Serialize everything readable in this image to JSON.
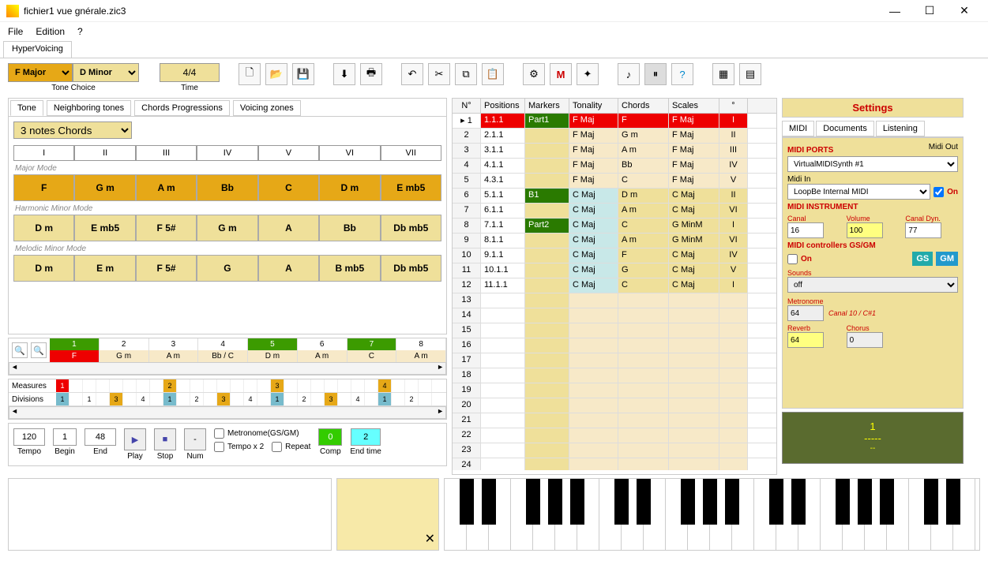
{
  "window": {
    "title": "fichier1 vue gnérale.zic3"
  },
  "menu": {
    "file": "File",
    "edition": "Edition",
    "help": "?"
  },
  "app_tab": "HyperVoicing",
  "tone": {
    "major": "F Major",
    "minor": "D Minor",
    "label": "Tone Choice"
  },
  "time": {
    "value": "4/4",
    "label": "Time"
  },
  "subtabs": {
    "tone": "Tone",
    "neighbor": "Neighboring tones",
    "prog": "Chords Progressions",
    "voicing": "Voicing zones"
  },
  "chord_type": "3 notes Chords",
  "degrees": [
    "I",
    "II",
    "III",
    "IV",
    "V",
    "VI",
    "VII"
  ],
  "modes": {
    "major": {
      "label": "Major Mode",
      "chords": [
        "F",
        "G m",
        "A m",
        "Bb",
        "C",
        "D m",
        "E mb5"
      ]
    },
    "harmonic": {
      "label": "Harmonic Minor Mode",
      "chords": [
        "D m",
        "E mb5",
        "F 5#",
        "G m",
        "A",
        "Bb",
        "Db mb5"
      ]
    },
    "melodic": {
      "label": "Melodic Minor Mode",
      "chords": [
        "D m",
        "E m",
        "F 5#",
        "G",
        "A",
        "B mb5",
        "Db mb5"
      ]
    }
  },
  "seq": {
    "nums": [
      "1",
      "2",
      "3",
      "4",
      "5",
      "6",
      "7",
      "8"
    ],
    "greens": [
      0,
      4,
      6
    ],
    "chords": [
      "F",
      "G m",
      "A m",
      "Bb / C",
      "D m",
      "A m",
      "C",
      "A m"
    ],
    "red": 0
  },
  "meas": {
    "label_m": "Measures",
    "label_d": "Divisions",
    "measures": [
      {
        "v": "1",
        "c": "r"
      },
      {
        "v": ""
      },
      {
        "v": ""
      },
      {
        "v": ""
      },
      {
        "v": ""
      },
      {
        "v": ""
      },
      {
        "v": ""
      },
      {
        "v": ""
      },
      {
        "v": "2",
        "c": "o"
      },
      {
        "v": ""
      },
      {
        "v": ""
      },
      {
        "v": ""
      },
      {
        "v": ""
      },
      {
        "v": ""
      },
      {
        "v": ""
      },
      {
        "v": ""
      },
      {
        "v": "3",
        "c": "o"
      },
      {
        "v": ""
      },
      {
        "v": ""
      },
      {
        "v": ""
      },
      {
        "v": ""
      },
      {
        "v": ""
      },
      {
        "v": ""
      },
      {
        "v": ""
      },
      {
        "v": "4",
        "c": "o"
      },
      {
        "v": ""
      },
      {
        "v": ""
      },
      {
        "v": ""
      }
    ],
    "divisions": [
      {
        "v": "1",
        "c": "b"
      },
      {
        "v": ""
      },
      {
        "v": "1"
      },
      {
        "v": ""
      },
      {
        "v": "3",
        "c": "o"
      },
      {
        "v": ""
      },
      {
        "v": "4"
      },
      {
        "v": ""
      },
      {
        "v": "1",
        "c": "b"
      },
      {
        "v": ""
      },
      {
        "v": "2"
      },
      {
        "v": ""
      },
      {
        "v": "3",
        "c": "o"
      },
      {
        "v": ""
      },
      {
        "v": "4"
      },
      {
        "v": ""
      },
      {
        "v": "1",
        "c": "b"
      },
      {
        "v": ""
      },
      {
        "v": "2"
      },
      {
        "v": ""
      },
      {
        "v": "3",
        "c": "o"
      },
      {
        "v": ""
      },
      {
        "v": "4"
      },
      {
        "v": ""
      },
      {
        "v": "1",
        "c": "b"
      },
      {
        "v": ""
      },
      {
        "v": "2"
      },
      {
        "v": ""
      }
    ]
  },
  "transport": {
    "tempo": "120",
    "tempo_l": "Tempo",
    "begin": "1",
    "begin_l": "Begin",
    "end": "48",
    "end_l": "End",
    "play_l": "Play",
    "stop_l": "Stop",
    "num_l": "Num",
    "num_btn": "-",
    "metronome": "Metronome(GS/GM)",
    "tempox2": "Tempo x 2",
    "repeat": "Repeat",
    "comp": "0",
    "comp_l": "Comp",
    "endtime": "2",
    "endtime_l": "End time"
  },
  "table": {
    "headers": {
      "n": "N°",
      "pos": "Positions",
      "mk": "Markers",
      "ton": "Tonality",
      "ch": "Chords",
      "sc": "Scales",
      "deg": "°"
    },
    "rows": [
      {
        "n": "1",
        "pos": "1.1.1",
        "mk": "Part1",
        "ton": "F Maj",
        "ch": "F",
        "sc": "F Maj",
        "deg": "I",
        "red": true,
        "mkdark": true
      },
      {
        "n": "2",
        "pos": "2.1.1",
        "mk": "",
        "ton": "F Maj",
        "ch": "G m",
        "sc": "F Maj",
        "deg": "II"
      },
      {
        "n": "3",
        "pos": "3.1.1",
        "mk": "",
        "ton": "F Maj",
        "ch": "A m",
        "sc": "F Maj",
        "deg": "III"
      },
      {
        "n": "4",
        "pos": "4.1.1",
        "mk": "",
        "ton": "F Maj",
        "ch": "Bb",
        "sc": "F Maj",
        "deg": "IV"
      },
      {
        "n": "5",
        "pos": "4.3.1",
        "mk": "",
        "ton": "F Maj",
        "ch": "C",
        "sc": "F Maj",
        "deg": "V"
      },
      {
        "n": "6",
        "pos": "5.1.1",
        "mk": "B1",
        "ton": "C Maj",
        "ch": "D m",
        "sc": "C Maj",
        "deg": "II",
        "mkdark": true,
        "c": true
      },
      {
        "n": "7",
        "pos": "6.1.1",
        "mk": "",
        "ton": "C Maj",
        "ch": "A m",
        "sc": "C Maj",
        "deg": "VI",
        "c": true
      },
      {
        "n": "8",
        "pos": "7.1.1",
        "mk": "Part2",
        "ton": "C Maj",
        "ch": "C",
        "sc": "G MinM",
        "deg": "I",
        "mkdark": true,
        "c": true
      },
      {
        "n": "9",
        "pos": "8.1.1",
        "mk": "",
        "ton": "C Maj",
        "ch": "A m",
        "sc": "G MinM",
        "deg": "VI",
        "c": true
      },
      {
        "n": "10",
        "pos": "9.1.1",
        "mk": "",
        "ton": "C Maj",
        "ch": "F",
        "sc": "C Maj",
        "deg": "IV",
        "c": true
      },
      {
        "n": "11",
        "pos": "10.1.1",
        "mk": "",
        "ton": "C Maj",
        "ch": "G",
        "sc": "C Maj",
        "deg": "V",
        "c": true
      },
      {
        "n": "12",
        "pos": "11.1.1",
        "mk": "",
        "ton": "C Maj",
        "ch": "C",
        "sc": "C Maj",
        "deg": "I",
        "c": true
      },
      {
        "n": "13"
      },
      {
        "n": "14"
      },
      {
        "n": "15"
      },
      {
        "n": "16"
      },
      {
        "n": "17"
      },
      {
        "n": "18"
      },
      {
        "n": "19"
      },
      {
        "n": "20"
      },
      {
        "n": "21"
      },
      {
        "n": "22"
      },
      {
        "n": "23"
      },
      {
        "n": "24"
      }
    ]
  },
  "settings": {
    "title": "Settings",
    "tabs": {
      "midi": "MIDI",
      "docs": "Documents",
      "listen": "Listening"
    },
    "ports": "MIDI PORTS",
    "midi_out": "Midi Out",
    "midi_out_v": "VirtualMIDISynth #1",
    "midi_in": "Midi In",
    "midi_in_v": "LoopBe Internal MIDI",
    "on": "On",
    "instr": "MIDI INSTRUMENT",
    "canal": "Canal",
    "canal_v": "16",
    "volume": "Volume",
    "volume_v": "100",
    "dyn": "Canal Dyn.",
    "dyn_v": "77",
    "ctrl": "MIDI controllers GS/GM",
    "gs": "GS",
    "gm": "GM",
    "sounds": "Sounds",
    "sounds_v": "off",
    "metro": "Metronome",
    "metro_v": "64",
    "metro_note": "Canal 10 / C#1",
    "reverb": "Reverb",
    "reverb_v": "64",
    "chorus": "Chorus",
    "chorus_v": "0"
  },
  "status": {
    "line1": "1",
    "line2": "-----",
    "line3": "--"
  }
}
